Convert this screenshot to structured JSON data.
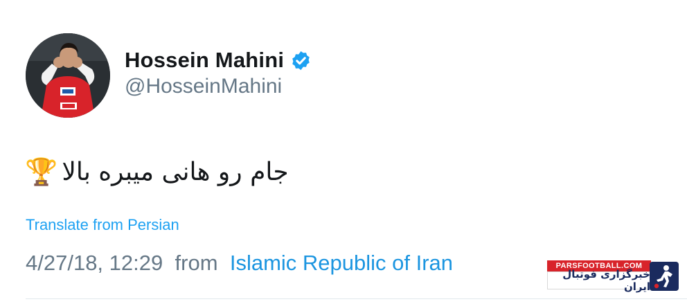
{
  "user": {
    "display_name": "Hossein Mahini",
    "handle": "@HosseinMahini",
    "verified_icon": "verified-badge-icon",
    "avatar_icon": "profile-avatar"
  },
  "tweet": {
    "text": "جام رو هانی میبره بالا",
    "emoji": "🏆",
    "emoji_icon": "trophy-icon"
  },
  "actions": {
    "translate_label": "Translate from Persian"
  },
  "meta": {
    "date_time": "4/27/18, 12:29",
    "from_label": "from",
    "location": "Islamic Republic of Iran"
  },
  "watermark": {
    "site": "PARSFOOTBALL.COM",
    "tagline": "خبرگزاری فوتبال ایران",
    "icon": "footballer-logo-icon"
  },
  "colors": {
    "link_blue": "#1da1f2",
    "muted_gray": "#657786",
    "text_dark": "#14171a",
    "watermark_red": "#d8232a"
  }
}
